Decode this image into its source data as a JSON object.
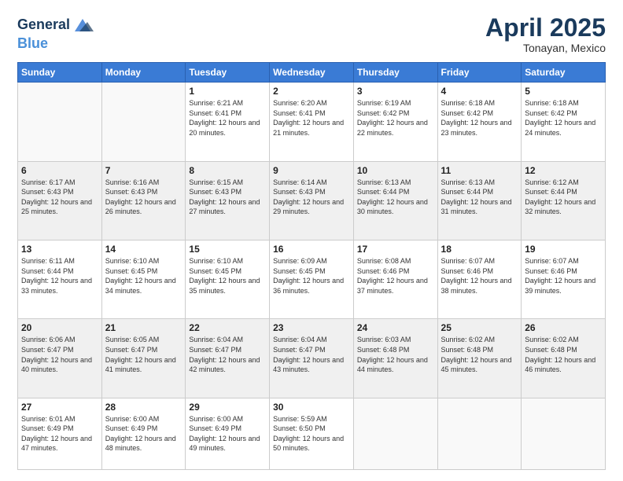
{
  "header": {
    "logo_line1": "General",
    "logo_line2": "Blue",
    "title": "April 2025",
    "subtitle": "Tonayan, Mexico"
  },
  "days_of_week": [
    "Sunday",
    "Monday",
    "Tuesday",
    "Wednesday",
    "Thursday",
    "Friday",
    "Saturday"
  ],
  "weeks": [
    [
      {
        "day": "",
        "sunrise": "",
        "sunset": "",
        "daylight": ""
      },
      {
        "day": "",
        "sunrise": "",
        "sunset": "",
        "daylight": ""
      },
      {
        "day": "1",
        "sunrise": "Sunrise: 6:21 AM",
        "sunset": "Sunset: 6:41 PM",
        "daylight": "Daylight: 12 hours and 20 minutes."
      },
      {
        "day": "2",
        "sunrise": "Sunrise: 6:20 AM",
        "sunset": "Sunset: 6:41 PM",
        "daylight": "Daylight: 12 hours and 21 minutes."
      },
      {
        "day": "3",
        "sunrise": "Sunrise: 6:19 AM",
        "sunset": "Sunset: 6:42 PM",
        "daylight": "Daylight: 12 hours and 22 minutes."
      },
      {
        "day": "4",
        "sunrise": "Sunrise: 6:18 AM",
        "sunset": "Sunset: 6:42 PM",
        "daylight": "Daylight: 12 hours and 23 minutes."
      },
      {
        "day": "5",
        "sunrise": "Sunrise: 6:18 AM",
        "sunset": "Sunset: 6:42 PM",
        "daylight": "Daylight: 12 hours and 24 minutes."
      }
    ],
    [
      {
        "day": "6",
        "sunrise": "Sunrise: 6:17 AM",
        "sunset": "Sunset: 6:43 PM",
        "daylight": "Daylight: 12 hours and 25 minutes."
      },
      {
        "day": "7",
        "sunrise": "Sunrise: 6:16 AM",
        "sunset": "Sunset: 6:43 PM",
        "daylight": "Daylight: 12 hours and 26 minutes."
      },
      {
        "day": "8",
        "sunrise": "Sunrise: 6:15 AM",
        "sunset": "Sunset: 6:43 PM",
        "daylight": "Daylight: 12 hours and 27 minutes."
      },
      {
        "day": "9",
        "sunrise": "Sunrise: 6:14 AM",
        "sunset": "Sunset: 6:43 PM",
        "daylight": "Daylight: 12 hours and 29 minutes."
      },
      {
        "day": "10",
        "sunrise": "Sunrise: 6:13 AM",
        "sunset": "Sunset: 6:44 PM",
        "daylight": "Daylight: 12 hours and 30 minutes."
      },
      {
        "day": "11",
        "sunrise": "Sunrise: 6:13 AM",
        "sunset": "Sunset: 6:44 PM",
        "daylight": "Daylight: 12 hours and 31 minutes."
      },
      {
        "day": "12",
        "sunrise": "Sunrise: 6:12 AM",
        "sunset": "Sunset: 6:44 PM",
        "daylight": "Daylight: 12 hours and 32 minutes."
      }
    ],
    [
      {
        "day": "13",
        "sunrise": "Sunrise: 6:11 AM",
        "sunset": "Sunset: 6:44 PM",
        "daylight": "Daylight: 12 hours and 33 minutes."
      },
      {
        "day": "14",
        "sunrise": "Sunrise: 6:10 AM",
        "sunset": "Sunset: 6:45 PM",
        "daylight": "Daylight: 12 hours and 34 minutes."
      },
      {
        "day": "15",
        "sunrise": "Sunrise: 6:10 AM",
        "sunset": "Sunset: 6:45 PM",
        "daylight": "Daylight: 12 hours and 35 minutes."
      },
      {
        "day": "16",
        "sunrise": "Sunrise: 6:09 AM",
        "sunset": "Sunset: 6:45 PM",
        "daylight": "Daylight: 12 hours and 36 minutes."
      },
      {
        "day": "17",
        "sunrise": "Sunrise: 6:08 AM",
        "sunset": "Sunset: 6:46 PM",
        "daylight": "Daylight: 12 hours and 37 minutes."
      },
      {
        "day": "18",
        "sunrise": "Sunrise: 6:07 AM",
        "sunset": "Sunset: 6:46 PM",
        "daylight": "Daylight: 12 hours and 38 minutes."
      },
      {
        "day": "19",
        "sunrise": "Sunrise: 6:07 AM",
        "sunset": "Sunset: 6:46 PM",
        "daylight": "Daylight: 12 hours and 39 minutes."
      }
    ],
    [
      {
        "day": "20",
        "sunrise": "Sunrise: 6:06 AM",
        "sunset": "Sunset: 6:47 PM",
        "daylight": "Daylight: 12 hours and 40 minutes."
      },
      {
        "day": "21",
        "sunrise": "Sunrise: 6:05 AM",
        "sunset": "Sunset: 6:47 PM",
        "daylight": "Daylight: 12 hours and 41 minutes."
      },
      {
        "day": "22",
        "sunrise": "Sunrise: 6:04 AM",
        "sunset": "Sunset: 6:47 PM",
        "daylight": "Daylight: 12 hours and 42 minutes."
      },
      {
        "day": "23",
        "sunrise": "Sunrise: 6:04 AM",
        "sunset": "Sunset: 6:47 PM",
        "daylight": "Daylight: 12 hours and 43 minutes."
      },
      {
        "day": "24",
        "sunrise": "Sunrise: 6:03 AM",
        "sunset": "Sunset: 6:48 PM",
        "daylight": "Daylight: 12 hours and 44 minutes."
      },
      {
        "day": "25",
        "sunrise": "Sunrise: 6:02 AM",
        "sunset": "Sunset: 6:48 PM",
        "daylight": "Daylight: 12 hours and 45 minutes."
      },
      {
        "day": "26",
        "sunrise": "Sunrise: 6:02 AM",
        "sunset": "Sunset: 6:48 PM",
        "daylight": "Daylight: 12 hours and 46 minutes."
      }
    ],
    [
      {
        "day": "27",
        "sunrise": "Sunrise: 6:01 AM",
        "sunset": "Sunset: 6:49 PM",
        "daylight": "Daylight: 12 hours and 47 minutes."
      },
      {
        "day": "28",
        "sunrise": "Sunrise: 6:00 AM",
        "sunset": "Sunset: 6:49 PM",
        "daylight": "Daylight: 12 hours and 48 minutes."
      },
      {
        "day": "29",
        "sunrise": "Sunrise: 6:00 AM",
        "sunset": "Sunset: 6:49 PM",
        "daylight": "Daylight: 12 hours and 49 minutes."
      },
      {
        "day": "30",
        "sunrise": "Sunrise: 5:59 AM",
        "sunset": "Sunset: 6:50 PM",
        "daylight": "Daylight: 12 hours and 50 minutes."
      },
      {
        "day": "",
        "sunrise": "",
        "sunset": "",
        "daylight": ""
      },
      {
        "day": "",
        "sunrise": "",
        "sunset": "",
        "daylight": ""
      },
      {
        "day": "",
        "sunrise": "",
        "sunset": "",
        "daylight": ""
      }
    ]
  ]
}
